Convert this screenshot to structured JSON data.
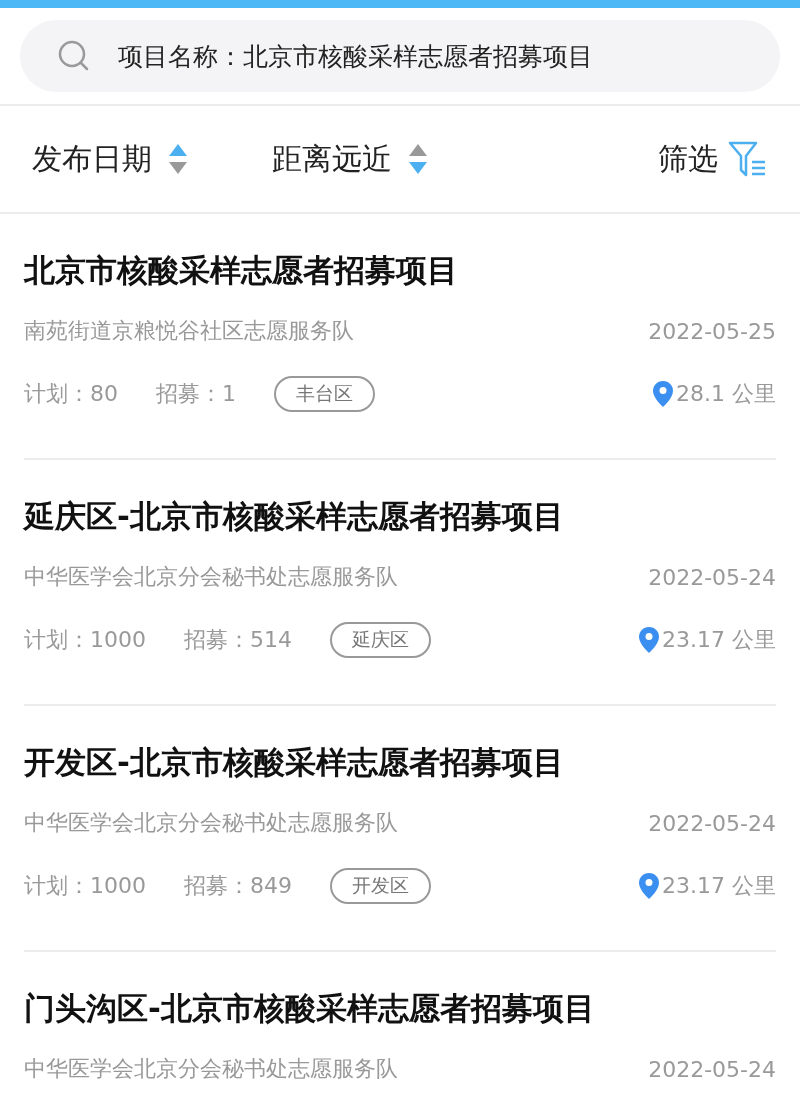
{
  "search": {
    "value": "项目名称：北京市核酸采样志愿者招募项目"
  },
  "sort_options": [
    {
      "label": "发布日期",
      "ascending": true
    },
    {
      "label": "距离远近",
      "ascending": false
    }
  ],
  "filter": {
    "label": "筛选"
  },
  "projects": [
    {
      "title": "北京市核酸采样志愿者招募项目",
      "organization": "南苑街道京粮悦谷社区志愿服务队",
      "date": "2022-05-25",
      "plan": "计划：80",
      "recruited": "招募：1",
      "district": "丰台区",
      "distance": "28.1 公里"
    },
    {
      "title": "延庆区-北京市核酸采样志愿者招募项目",
      "organization": "中华医学会北京分会秘书处志愿服务队",
      "date": "2022-05-24",
      "plan": "计划：1000",
      "recruited": "招募：514",
      "district": "延庆区",
      "distance": "23.17 公里"
    },
    {
      "title": "开发区-北京市核酸采样志愿者招募项目",
      "organization": "中华医学会北京分会秘书处志愿服务队",
      "date": "2022-05-24",
      "plan": "计划：1000",
      "recruited": "招募：849",
      "district": "开发区",
      "distance": "23.17 公里"
    },
    {
      "title": "门头沟区-北京市核酸采样志愿者招募项目",
      "organization": "中华医学会北京分会秘书处志愿服务队",
      "date": "2022-05-24"
    }
  ]
}
